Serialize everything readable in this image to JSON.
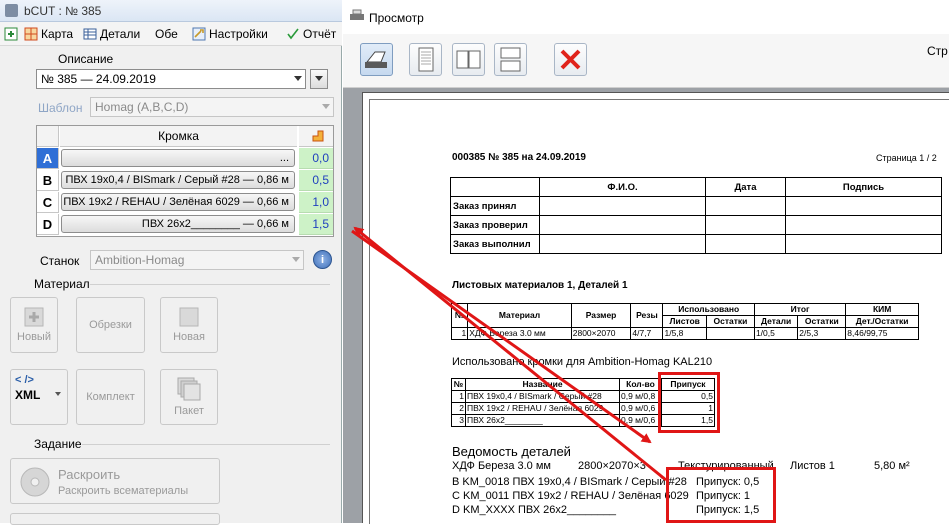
{
  "left_window": {
    "title": "bCUT : № 385",
    "toolbar": {
      "items": [
        "Карта",
        "Детали",
        "Обе",
        "Настройки",
        "Отчёт"
      ]
    },
    "description_label": "Описание",
    "order_value": "№ 385 — 24.09.2019",
    "template_label": "Шаблон",
    "template_value": "Homag (A,B,C,D)",
    "edge_table": {
      "header": "Кромка",
      "rows": [
        {
          "letter": "A",
          "name": "...",
          "allowance": "0,0"
        },
        {
          "letter": "B",
          "name": "ПВХ 19x0,4 / BISmark / Серый #28 — 0,86 м",
          "allowance": "0,5"
        },
        {
          "letter": "C",
          "name": "ПВХ 19x2 / REHAU / Зелёная 6029 — 0,66 м",
          "allowance": "1,0"
        },
        {
          "letter": "D",
          "name": "ПВХ 26x2________ — 0,66 м",
          "allowance": "1,5"
        }
      ]
    },
    "machine_label": "Станок",
    "machine_value": "Ambition-Homag",
    "material_section": "Материал",
    "material_buttons": {
      "new_label": "Новый",
      "offcuts_label": "Обрезки",
      "new2_label": "Новая"
    },
    "xml_label": "XML",
    "xml_tag": "< />",
    "kit_label": "Комплект",
    "packet_label": "Пакет",
    "task_section": "Задание",
    "cut_title": "Раскроить",
    "cut_sub": "Раскроить всематериалы"
  },
  "preview_window": {
    "title": "Просмотр",
    "toolbar_right_text": "Стр",
    "document": {
      "heading": "000385 № 385 на 24.09.2019",
      "page": "Страница 1 / 2",
      "signature_table": {
        "headers": [
          "",
          "Ф.И.О.",
          "Дата",
          "Подпись"
        ],
        "rows": [
          "Заказ принял",
          "Заказ проверил",
          "Заказ выполнил"
        ]
      },
      "sheet_title": "Листовых материалов 1, Деталей 1",
      "sheet_table": {
        "h1": [
          "№",
          "Материал",
          "Размер",
          "Резы",
          "Использовано",
          "Итог",
          "КИМ"
        ],
        "h2": [
          "Листов",
          "Остатки",
          "Детали",
          "Остатки",
          "Дет./Остатки"
        ],
        "row": [
          "1",
          "ХДФ Береза 3.0 мм",
          "2800×2070",
          "4/7,7",
          "1/5,8",
          "",
          "1/0,5",
          "2/5,3",
          "8,46/99,75"
        ]
      },
      "edges_title": "Использовано кромки для Ambition-Homag KAL210",
      "edges_table": {
        "headers": [
          "№",
          "Название",
          "Кол-во",
          "Припуск"
        ],
        "rows": [
          [
            "1",
            "ПВХ 19x0,4 / BISmark / Серый #28",
            "0,9 м/0,8",
            "0,5"
          ],
          [
            "2",
            "ПВХ 19x2 / REHAU / Зелёная 6029",
            "0,9 м/0,6",
            "1"
          ],
          [
            "3",
            "ПВХ 26x2________",
            "0,9 м/0,6",
            "1,5"
          ]
        ]
      },
      "parts_title": "Ведомость деталей",
      "parts_material": "ХДФ Береза 3.0 мм",
      "parts_size": "2800×2070×3",
      "parts_texture": "Текстурированный",
      "parts_sheets": "Листов 1",
      "parts_area": "5,80 м²",
      "parts_lines": [
        {
          "edge": "B KM_0018  ПВХ 19x0,4 / BISmark / Серый #28",
          "allowance": "Припуск: 0,5"
        },
        {
          "edge": "C KM_0011  ПВХ 19x2 / REHAU / Зелёная 6029",
          "allowance": "Припуск: 1"
        },
        {
          "edge": "D KM_XXXX  ПВХ 26x2________",
          "allowance": "Припуск: 1,5"
        }
      ]
    }
  },
  "colors": {
    "annotation": "#e01616",
    "allowance_bg": "#cdf2c7",
    "allowance_text": "#1f3fbf",
    "row_a_bg": "#2f6fd6"
  }
}
